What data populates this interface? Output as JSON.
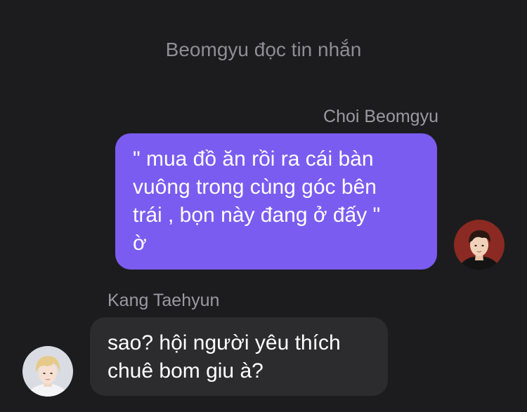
{
  "header": {
    "status": "Beomgyu đọc tin nhắn"
  },
  "messages": [
    {
      "sender": "Choi Beomgyu",
      "side": "right",
      "text_lines": [
        "\" mua đồ ăn rồi ra cái bàn",
        "vuông trong cùng góc bên",
        "trái , bọn này đang ở đấy \"",
        "ờ"
      ],
      "bubble_color": "#7b5cf0"
    },
    {
      "sender": "Kang Taehyun",
      "side": "left",
      "text_lines": [
        "sao? hội người yêu thích",
        "chuê bom giu à?"
      ],
      "bubble_color": "#2c2c2e"
    }
  ],
  "colors": {
    "background": "#1c1c1e",
    "secondary_text": "#8e8e93"
  }
}
